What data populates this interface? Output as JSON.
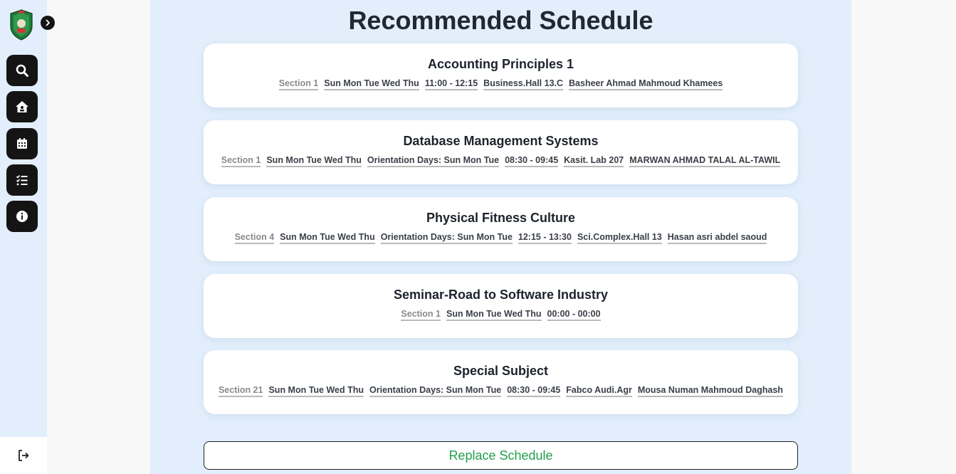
{
  "page": {
    "title": "Recommended Schedule"
  },
  "sidebar": {
    "toggle_icon": "chevron-right-icon",
    "items": [
      {
        "icon": "search-icon"
      },
      {
        "icon": "home-icon"
      },
      {
        "icon": "calendar-icon"
      },
      {
        "icon": "checklist-icon"
      },
      {
        "icon": "info-icon"
      }
    ],
    "logout_icon": "logout-icon"
  },
  "courses": [
    {
      "name": "Accounting Principles 1",
      "section": "Section 1",
      "days": "Sun Mon Tue Wed Thu",
      "orientation": "",
      "time": "11:00 - 12:15",
      "location": "Business.Hall 13.C",
      "instructor": "Basheer Ahmad Mahmoud Khamees"
    },
    {
      "name": "Database Management Systems",
      "section": "Section 1",
      "days": "Sun Mon Tue Wed Thu",
      "orientation": "Orientation Days: Sun Mon Tue",
      "time": "08:30 - 09:45",
      "location": "Kasit. Lab 207",
      "instructor": "MARWAN AHMAD TALAL AL-TAWIL"
    },
    {
      "name": "Physical Fitness Culture",
      "section": "Section 4",
      "days": "Sun Mon Tue Wed Thu",
      "orientation": "Orientation Days: Sun Mon Tue",
      "time": "12:15 - 13:30",
      "location": "Sci.Complex.Hall 13",
      "instructor": "Hasan asri abdel saoud"
    },
    {
      "name": "Seminar-Road to Software Industry",
      "section": "Section 1",
      "days": "Sun Mon Tue Wed Thu",
      "orientation": "",
      "time": "00:00 - 00:00",
      "location": "",
      "instructor": ""
    },
    {
      "name": "Special Subject",
      "section": "Section 21",
      "days": "Sun Mon Tue Wed Thu",
      "orientation": "Orientation Days: Sun Mon Tue",
      "time": "08:30 - 09:45",
      "location": "Fabco Audi.Agr",
      "instructor": "Mousa Numan Mahmoud Daghash"
    }
  ],
  "actions": {
    "replace_label": "Replace Schedule"
  },
  "colors": {
    "accent_green": "#22a04b",
    "panel_bg": "#e2eefb",
    "nav_dark": "#141414"
  }
}
